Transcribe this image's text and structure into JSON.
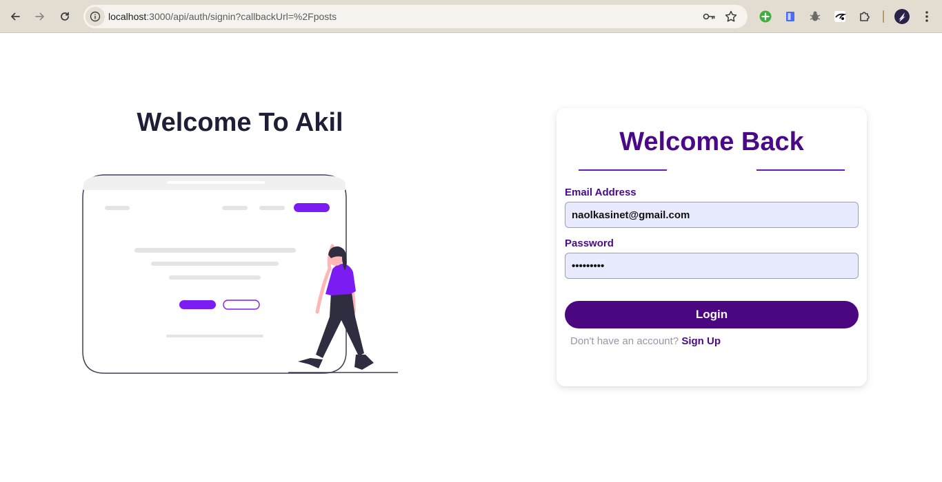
{
  "browser": {
    "url_host": "localhost",
    "url_path": ":3000/api/auth/signin?callbackUrl=%2Fposts",
    "icons": {
      "back": "arrow-left-icon",
      "forward": "arrow-right-icon",
      "reload": "reload-icon",
      "site_info": "site-info-icon",
      "password": "key-icon",
      "bookmark": "star-icon",
      "extensions": [
        "green-plus-extension-icon",
        "blue-extension-icon",
        "bug-extension-icon",
        "bird-extension-icon",
        "puzzle-icon"
      ],
      "profile": "profile-avatar-icon",
      "menu": "kebab-menu-icon"
    }
  },
  "hero": {
    "title": "Welcome To Akil"
  },
  "login": {
    "title": "Welcome Back",
    "email_label": "Email Address",
    "email_value": "naolkasinet@gmail.com",
    "password_label": "Password",
    "password_value": "123456789",
    "login_button": "Login",
    "signup_prompt": "Don't have an account?",
    "signup_link": "Sign Up"
  },
  "colors": {
    "brand_purple": "#4a0780",
    "illustration_accent": "#7b1cf2",
    "input_bg": "#e8eafd",
    "heading_dark": "#1c1f35"
  }
}
